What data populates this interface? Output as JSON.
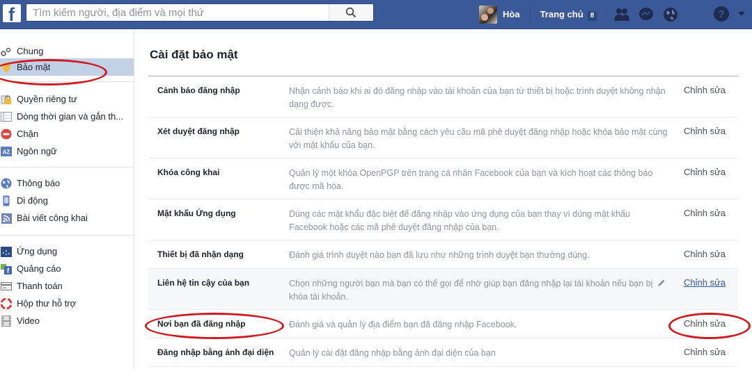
{
  "topbar": {
    "logo": "f",
    "search": {
      "placeholder": "Tìm kiếm người, địa điểm và mọi thứ",
      "value": ""
    },
    "user_name": "Hòa",
    "home_label": "Trang chủ",
    "home_badge": "8",
    "icons": [
      "friend-requests-icon",
      "messenger-icon",
      "notifications-globe-icon",
      "help-icon",
      "account-menu-caret-icon"
    ]
  },
  "sidebar": {
    "groups": [
      {
        "items": [
          {
            "label": "Chung",
            "icon": "gear-icon"
          },
          {
            "label": "Bảo mật",
            "icon": "shield-icon",
            "active": true
          }
        ]
      },
      {
        "items": [
          {
            "label": "Quyền riêng tư",
            "icon": "lock-icon"
          },
          {
            "label": "Dòng thời gian và gắn th...",
            "icon": "timeline-icon"
          },
          {
            "label": "Chặn",
            "icon": "block-icon"
          },
          {
            "label": "Ngôn ngữ",
            "icon": "language-icon"
          }
        ]
      },
      {
        "items": [
          {
            "label": "Thông báo",
            "icon": "globe-icon"
          },
          {
            "label": "Di động",
            "icon": "mobile-icon"
          },
          {
            "label": "Bài viết công khai",
            "icon": "rss-icon"
          }
        ]
      },
      {
        "items": [
          {
            "label": "Ứng dụng",
            "icon": "apps-icon"
          },
          {
            "label": "Quảng cáo",
            "icon": "ads-icon"
          },
          {
            "label": "Thanh toán",
            "icon": "credit-card-icon"
          },
          {
            "label": "Hộp thư hỗ trợ",
            "icon": "lifebuoy-icon"
          },
          {
            "label": "Video",
            "icon": "film-icon"
          }
        ]
      }
    ]
  },
  "main": {
    "title": "Cài đặt bảo mật",
    "edit_label": "Chỉnh sửa",
    "rows": [
      {
        "label": "Cảnh báo đăng nhập",
        "description": "Nhận cảnh báo khi ai đó đăng nhập vào tài khoản của bạn từ thiết bị hoặc trình duyệt không nhận dạng được."
      },
      {
        "label": "Xét duyệt đăng nhập",
        "description": "Cải thiện khả năng bảo mật bằng cách yêu cầu mã phê duyệt đăng nhập hoặc khóa bảo mật cùng với mật khẩu của bạn."
      },
      {
        "label": "Khóa công khai",
        "description": "Quản lý một khóa OpenPGP trên trang cá nhân Facebook của bạn và kích hoạt các thông báo được mã hóa."
      },
      {
        "label": "Mật khẩu Ứng dụng",
        "description": "Dùng các mật khẩu đặc biệt để đăng nhập vào ứng dụng của bạn thay vì dùng mật khẩu Facebook hoặc các mã phê duyệt đăng nhập của bạn."
      },
      {
        "label": "Thiết bị đã nhận dạng",
        "description": "Đánh giá trình duyệt nào bạn đã lưu như những trình duyệt bạn thường dùng."
      },
      {
        "label": "Liên hệ tin cậy của bạn",
        "description": "Chọn những người bạn mà bạn có thể gọi để nhờ giúp bạn đăng nhập lại tài khoản nếu bạn bị khóa tài khoản.",
        "hovered": true
      },
      {
        "label": "Nơi bạn đã đăng nhập",
        "description": "Đánh giá và quản lý địa điểm bạn đã đăng nhập Facebook.",
        "annotated": true
      },
      {
        "label": "Đăng nhập bằng ảnh đại diện",
        "description": "Quản lý cài đặt đăng nhập bằng ảnh đại diện của bạn"
      }
    ]
  },
  "colors": {
    "brand": "#3b5998",
    "active_sidebar": "#c2d1e6",
    "annotation": "#cc1a1f",
    "link": "#365899"
  }
}
